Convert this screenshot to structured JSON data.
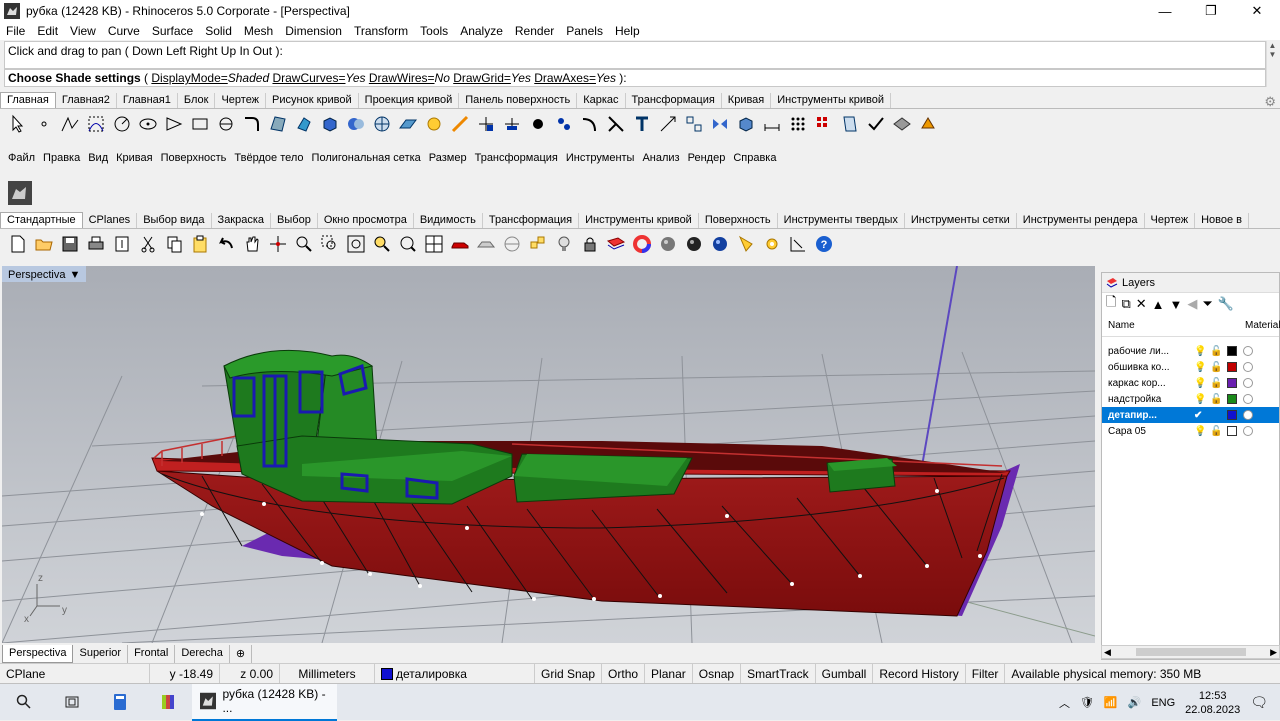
{
  "window": {
    "title": "рубка (12428 KB) - Rhinoceros  5.0 Corporate - [Perspectiva]",
    "minimize": "—",
    "maximize": "❐",
    "close": "✕"
  },
  "menu": [
    "File",
    "Edit",
    "View",
    "Curve",
    "Surface",
    "Solid",
    "Mesh",
    "Dimension",
    "Transform",
    "Tools",
    "Analyze",
    "Render",
    "Panels",
    "Help"
  ],
  "command": {
    "history": "Click and drag to pan ( Down  Left  Right  Up  In  Out ):",
    "prompt": "Choose Shade settings",
    "open": " ( ",
    "opt1": "DisplayMode=",
    "opt1v": "Shaded",
    "opt2": "DrawCurves=",
    "opt2v": "Yes",
    "opt3": "DrawWires=",
    "opt3v": "No",
    "opt4": "DrawGrid=",
    "opt4v": "Yes",
    "opt5": "DrawAxes=",
    "opt5v": "Yes",
    "close": " ):"
  },
  "tabs1": [
    "Главная",
    "Главная2",
    "Главная1",
    "Блок",
    "Чертеж",
    "Рисунок кривой",
    "Проекция кривой",
    "Панель поверхность",
    "Каркас",
    "Трансформация",
    "Кривая",
    "Инструменты кривой"
  ],
  "ru_menu": [
    "Файл",
    "Правка",
    "Вид",
    "Кривая",
    "Поверхность",
    "Твёрдое тело",
    "Полигональная сетка",
    "Размер",
    "Трансформация",
    "Инструменты",
    "Анализ",
    "Рендер",
    "Справка"
  ],
  "tabs2": [
    "Стандартные",
    "CPlanes",
    "Выбор вида",
    "Закраска",
    "Выбор",
    "Окно просмотра",
    "Видимость",
    "Трансформация",
    "Инструменты кривой",
    "Поверхность",
    "Инструменты твердых",
    "Инструменты сетки",
    "Инструменты рендера",
    "Чертеж",
    "Новое в"
  ],
  "viewport": {
    "name": "Perspectiva",
    "arrow": "▼",
    "axis_x": "x",
    "axis_y": "y",
    "axis_z": "z"
  },
  "viewtabs": [
    "Perspectiva",
    "Superior",
    "Frontal",
    "Derecha"
  ],
  "viewtabs_add": "⊕",
  "layers": {
    "title": "Layers",
    "col_name": "Name",
    "col_material": "Material",
    "rows": [
      {
        "name": "рабочие ли...",
        "color": "#000000",
        "selected": false
      },
      {
        "name": "обшивка ко...",
        "color": "#c00000",
        "selected": false
      },
      {
        "name": "каркас кор...",
        "color": "#6a1fb0",
        "selected": false
      },
      {
        "name": "надстройка",
        "color": "#1a8a1a",
        "selected": false
      },
      {
        "name": "детапир...",
        "color": "#1010d0",
        "selected": true
      },
      {
        "name": "Сара 05",
        "color": "#ffffff",
        "selected": false
      }
    ]
  },
  "status": {
    "cplane": "CPlane",
    "y": "y -18.49",
    "z": "z 0.00",
    "units": "Millimeters",
    "layer": "деталировка",
    "gridsnap": "Grid Snap",
    "ortho": "Ortho",
    "planar": "Planar",
    "osnap": "Osnap",
    "smarttrack": "SmartTrack",
    "gumball": "Gumball",
    "record": "Record History",
    "filter": "Filter",
    "memory": "Available physical memory: 350 MB",
    "layer_color": "#1010d0"
  },
  "taskbar": {
    "app": "рубка (12428 KB) - ...",
    "lang": "ENG",
    "time": "12:53",
    "date": "22.08.2023"
  }
}
